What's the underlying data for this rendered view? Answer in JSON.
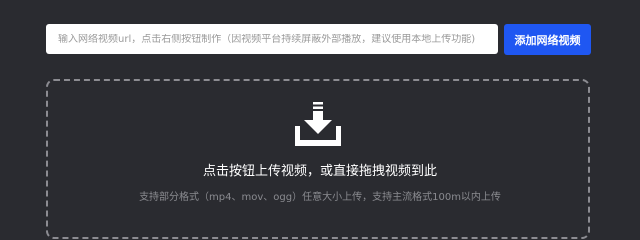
{
  "url_input": {
    "placeholder": "输入网络视频url，点击右侧按钮制作（因视频平台持续屏蔽外部播放，建议使用本地上传功能)",
    "value": ""
  },
  "add_button": {
    "label": "添加网络视频"
  },
  "drop_zone": {
    "icon": "download-icon",
    "title": "点击按钮上传视频，或直接拖拽视频到此",
    "hint": "支持部分格式（mp4、mov、ogg）任意大小上传，支持主流格式100m以内上传"
  },
  "colors": {
    "background": "#2a2b30",
    "accent": "#1f57f2",
    "dashed_border": "#8c8c92"
  }
}
